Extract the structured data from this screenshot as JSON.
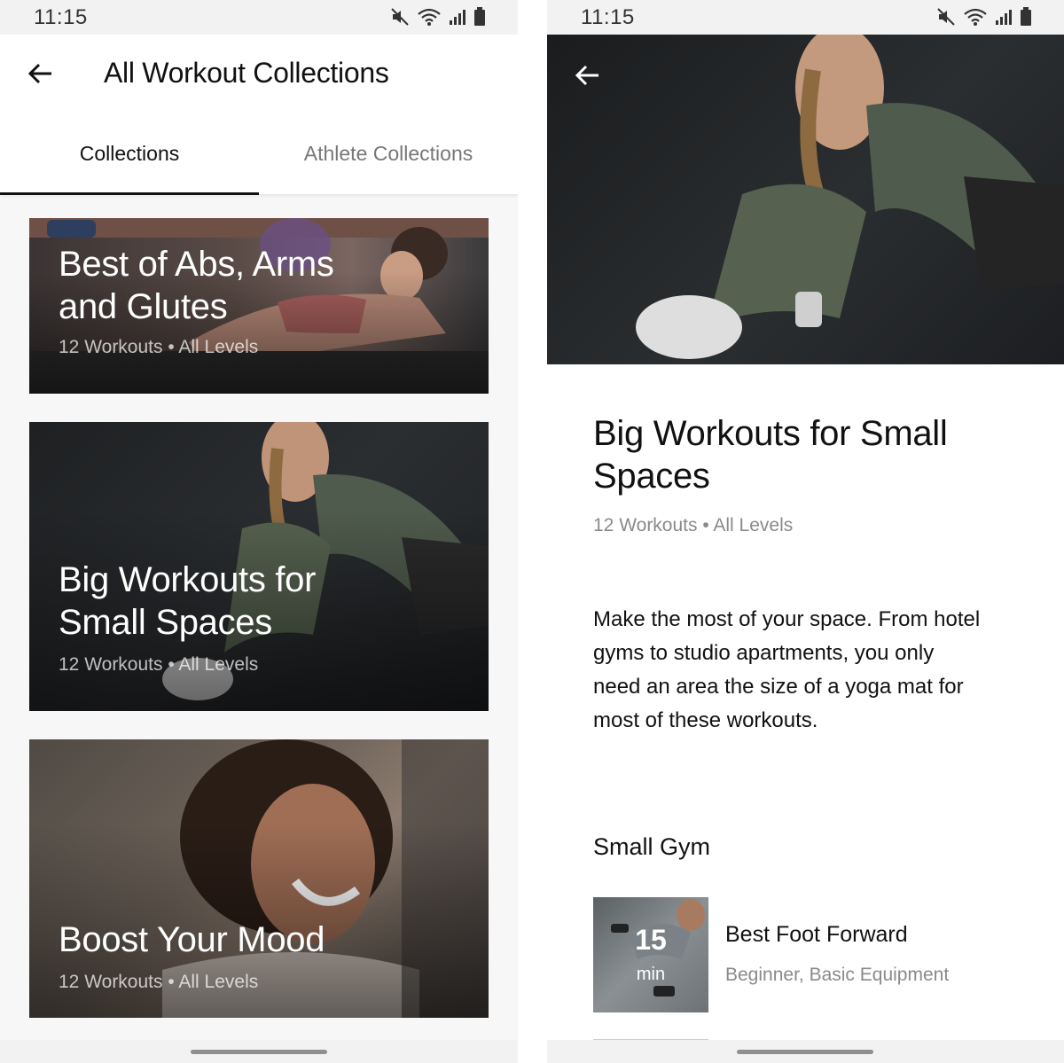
{
  "left": {
    "status": {
      "time": "11:15"
    },
    "header": {
      "title": "All Workout Collections"
    },
    "tabs": [
      {
        "label": "Collections",
        "active": true
      },
      {
        "label": "Athlete Collections",
        "active": false
      }
    ],
    "cards": [
      {
        "title_line1": "Best of Abs, Arms",
        "title_line2": "and Glutes",
        "meta": "12 Workouts • All Levels"
      },
      {
        "title_line1": "Big Workouts for",
        "title_line2": "Small Spaces",
        "meta": "12 Workouts • All Levels"
      },
      {
        "title_line1": "Boost Your Mood",
        "meta": "12 Workouts • All Levels"
      }
    ]
  },
  "right": {
    "status": {
      "time": "11:15"
    },
    "collection": {
      "title_line1": "Big Workouts for Small",
      "title_line2": "Spaces",
      "meta": "12 Workouts • All Levels",
      "description_lines": [
        "Make the most of your space. From hotel",
        "gyms to studio apartments, you only",
        "need an area the size of a yoga mat for",
        "most of these workouts."
      ]
    },
    "section": {
      "title": "Small Gym"
    },
    "workouts": [
      {
        "duration": "15",
        "unit": "min",
        "title": "Best Foot Forward",
        "meta": "Beginner, Basic Equipment"
      }
    ]
  },
  "icons": {
    "back": "arrow-left-icon",
    "status": [
      "mute-icon",
      "wifi-icon",
      "signal-icon",
      "battery-icon"
    ]
  },
  "colors": {
    "text_primary": "#111111",
    "text_secondary": "#8a8a8a",
    "tab_indicator": "#111111"
  }
}
